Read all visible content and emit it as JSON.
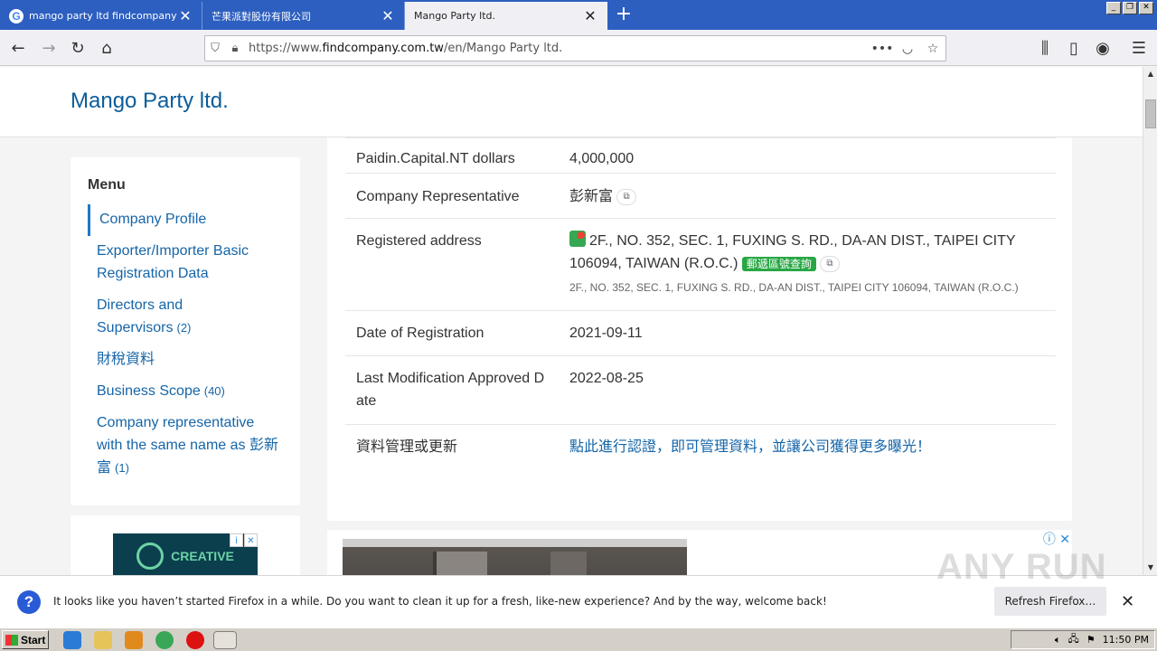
{
  "browser": {
    "tabs": [
      {
        "title": "mango party ltd findcompany - Go",
        "active": false
      },
      {
        "title": "芒果派對股份有限公司",
        "active": false
      },
      {
        "title": "Mango Party ltd.",
        "active": true
      }
    ],
    "new_tab_label": "+",
    "url_prefix": "https://www.",
    "url_domain": "findcompany.com.tw",
    "url_suffix": "/en/Mango Party ltd.",
    "colors": {
      "tabbar": "#2d5fc0",
      "link": "#1565a8",
      "title": "#0b5d9a"
    }
  },
  "site": {
    "title": "Mango Party ltd."
  },
  "menu": {
    "heading": "Menu",
    "items": [
      {
        "label": "Company Profile",
        "count": ""
      },
      {
        "label": "Exporter/Importer Basic Registration Data",
        "count": ""
      },
      {
        "label": "Directors and Supervisors",
        "count": "(2)"
      },
      {
        "label": "財稅資料",
        "count": ""
      },
      {
        "label": "Business Scope",
        "count": "(40)"
      },
      {
        "label": "Company representative with the same name as 彭新富",
        "count": "(1)"
      }
    ]
  },
  "ad_small": {
    "text": "CREATIVE",
    "info": "i",
    "close": "✕"
  },
  "details": {
    "rows": [
      {
        "label": "Paidin.Capital.NT dollars",
        "value": "4,000,000"
      },
      {
        "label": "Company Representative",
        "value": "彭新富"
      },
      {
        "label": "Registered address",
        "value": "2F., NO. 352, SEC. 1, FUXING S. RD., DA-AN DIST., TAIPEI CITY 106094, TAIWAN (R.O.C.)",
        "badge": "郵遞區號查詢",
        "sub": "2F., NO. 352, SEC. 1, FUXING S. RD., DA-AN DIST., TAIPEI CITY 106094, TAIWAN (R.O.C.)"
      },
      {
        "label": "Date of Registration",
        "value": "2021-09-11"
      },
      {
        "label": "Last Modification Approved Date",
        "value": "2022-08-25"
      },
      {
        "label": "資料管理或更新",
        "value": "點此進行認證，即可管理資料，並讓公司獲得更多曝光！"
      }
    ]
  },
  "notification": {
    "message": "It looks like you haven’t started Firefox in a while. Do you want to clean it up for a fresh, like-new experience? And by the way, welcome back!",
    "button": "Refresh Firefox…",
    "close": "✕"
  },
  "watermark": "ANY RUN",
  "taskbar": {
    "start": "Start",
    "time": "11:50 PM"
  }
}
